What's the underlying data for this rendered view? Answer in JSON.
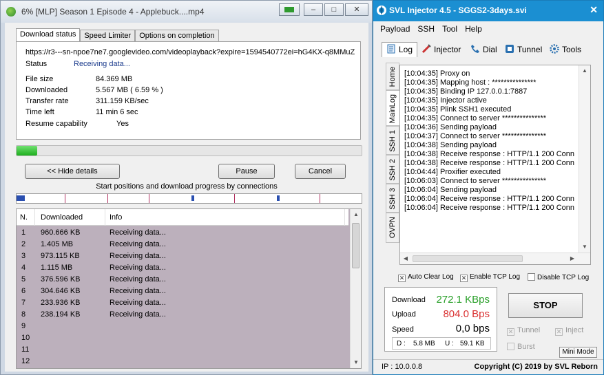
{
  "idm": {
    "title": "6% [MLP] Season 1 Episode 4 - Applebuck....mp4",
    "window_buttons": [
      "‒",
      "□",
      "✕"
    ],
    "tabs": [
      {
        "label": "Download status",
        "active": true
      },
      {
        "label": "Speed Limiter",
        "active": false
      },
      {
        "label": "Options on completion",
        "active": false
      }
    ],
    "url": "https://r3---sn-npoe7ne7.googlevideo.com/videoplayback?expire=1594540772ei=hG4KX-q8MMuZ",
    "status_label": "Status",
    "status_value": "Receiving data...",
    "fields": [
      {
        "label": "File size",
        "value": "84.369  MB"
      },
      {
        "label": "Downloaded",
        "value": "5.567  MB  ( 6.59 % )"
      },
      {
        "label": "Transfer rate",
        "value": "311.159  KB/sec"
      },
      {
        "label": "Time left",
        "value": "11 min 6 sec"
      },
      {
        "label": "Resume capability",
        "value": "Yes"
      }
    ],
    "progress_fraction": 0.059,
    "buttons": {
      "hide_details": "<< Hide details",
      "pause": "Pause",
      "cancel": "Cancel"
    },
    "start_positions_label": "Start positions and download progress by connections",
    "columns": {
      "n": "N.",
      "downloaded": "Downloaded",
      "info": "Info"
    },
    "rows": [
      {
        "n": "1",
        "downloaded": "960.666  KB",
        "info": "Receiving data..."
      },
      {
        "n": "2",
        "downloaded": "1.405  MB",
        "info": "Receiving data..."
      },
      {
        "n": "3",
        "downloaded": "973.115  KB",
        "info": "Receiving data..."
      },
      {
        "n": "4",
        "downloaded": "1.115  MB",
        "info": "Receiving data..."
      },
      {
        "n": "5",
        "downloaded": "376.596  KB",
        "info": "Receiving data..."
      },
      {
        "n": "6",
        "downloaded": "304.646  KB",
        "info": "Receiving data..."
      },
      {
        "n": "7",
        "downloaded": "233.936  KB",
        "info": "Receiving data..."
      },
      {
        "n": "8",
        "downloaded": "238.194  KB",
        "info": "Receiving data..."
      },
      {
        "n": "9",
        "downloaded": "",
        "info": ""
      },
      {
        "n": "10",
        "downloaded": "",
        "info": ""
      },
      {
        "n": "11",
        "downloaded": "",
        "info": ""
      },
      {
        "n": "12",
        "downloaded": "",
        "info": ""
      }
    ]
  },
  "svl": {
    "title": "SVL Injector 4.5 - SGGS2-3days.svi",
    "close": "✕",
    "menu": [
      "Payload",
      "SSH",
      "Tool",
      "Help"
    ],
    "tabs": [
      "Log",
      "Injector",
      "Dial",
      "Tunnel",
      "Tools"
    ],
    "side_tabs": [
      "Home",
      "MainLog",
      "SSH 1",
      "SSH 2",
      "SSH 3",
      "OVPN"
    ],
    "log": [
      "[10:04:35] Proxy on",
      "[10:04:35] Mapping host : ***************",
      "[10:04:35] Binding IP 127.0.0.1:7887",
      "[10:04:35] Injector active",
      "[10:04:35] Plink SSH1 executed",
      "[10:04:35] Connect to server ***************",
      "[10:04:36] Sending payload",
      "[10:04:37] Connect to server ***************",
      "[10:04:38] Sending payload",
      "[10:04:38] Receive response : HTTP/1.1 200 Conn",
      "[10:04:38] Receive response : HTTP/1.1 200 Conn",
      "[10:04:44] Proxifier executed",
      "[10:06:03] Connect to server ***************",
      "[10:06:04] Sending payload",
      "[10:06:04] Receive response : HTTP/1.1 200 Conn",
      "[10:06:04] Receive response : HTTP/1.1 200 Conn"
    ],
    "checkboxes": [
      {
        "label": "Auto Clear Log",
        "checked": true
      },
      {
        "label": "Enable TCP Log",
        "checked": true
      },
      {
        "label": "Disable TCP Log",
        "checked": false
      }
    ],
    "stats": {
      "download_label": "Download",
      "download_value": "272.1 KBps",
      "download_color": "#2aa02a",
      "upload_label": "Upload",
      "upload_value": "804.0 Bps",
      "upload_color": "#d93030",
      "speed_label": "Speed",
      "speed_value": "0,0 bps",
      "d_label": "D :",
      "d_value": "5.8 MB",
      "u_label": "U :",
      "u_value": "59.1 KB"
    },
    "stop_label": "STOP",
    "options": [
      {
        "label": "Tunnel",
        "checked": true
      },
      {
        "label": "Inject",
        "checked": true
      },
      {
        "label": "Burst",
        "checked": false
      }
    ],
    "mini_mode": "Mini Mode",
    "ip": "IP : 10.0.0.8",
    "copyright": "Copyright (C) 2019 by SVL Reborn"
  }
}
